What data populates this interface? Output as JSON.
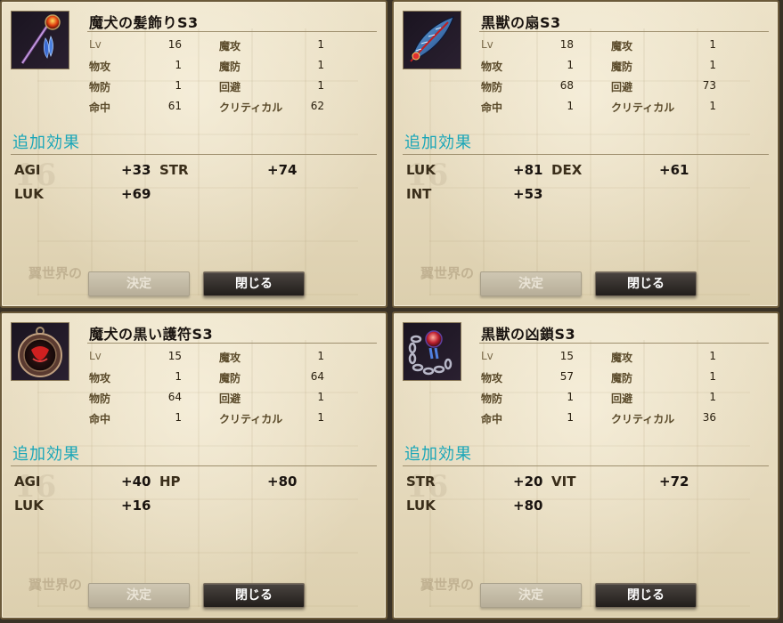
{
  "labels": {
    "lv": "Lv",
    "phys_atk": "物攻",
    "phys_def": "物防",
    "accuracy": "命中",
    "mag_atk": "魔攻",
    "mag_def": "魔防",
    "evasion": "回避",
    "critical": "クリティカル",
    "additional_effects": "追加効果",
    "decide_button": "決定",
    "close_button": "閉じる",
    "watermark": "翼世界の",
    "bg_number": "16"
  },
  "panels": [
    {
      "title": "魔犬の髪飾りS3",
      "icon": "hair-ornament-icon",
      "stats": {
        "lv": "16",
        "mag_atk": "1",
        "phys_atk": "1",
        "mag_def": "1",
        "phys_def": "1",
        "evasion": "1",
        "accuracy": "61",
        "critical": "62"
      },
      "bonuses": [
        {
          "n1": "AGI",
          "v1": "+33",
          "n2": "STR",
          "v2": "+74"
        },
        {
          "n1": "LUK",
          "v1": "+69",
          "n2": "",
          "v2": ""
        }
      ]
    },
    {
      "title": "黒獣の扇S3",
      "icon": "feather-fan-icon",
      "stats": {
        "lv": "18",
        "mag_atk": "1",
        "phys_atk": "1",
        "mag_def": "1",
        "phys_def": "68",
        "evasion": "73",
        "accuracy": "1",
        "critical": "1"
      },
      "bonuses": [
        {
          "n1": "LUK",
          "v1": "+81",
          "n2": "DEX",
          "v2": "+61"
        },
        {
          "n1": "INT",
          "v1": "+53",
          "n2": "",
          "v2": ""
        }
      ]
    },
    {
      "title": "魔犬の黒い護符S3",
      "icon": "amulet-icon",
      "stats": {
        "lv": "15",
        "mag_atk": "1",
        "phys_atk": "1",
        "mag_def": "64",
        "phys_def": "64",
        "evasion": "1",
        "accuracy": "1",
        "critical": "1"
      },
      "bonuses": [
        {
          "n1": "AGI",
          "v1": "+40",
          "n2": "HP",
          "v2": "+80"
        },
        {
          "n1": "LUK",
          "v1": "+16",
          "n2": "",
          "v2": ""
        }
      ]
    },
    {
      "title": "黒獣の凶鎖S3",
      "icon": "chain-icon",
      "stats": {
        "lv": "15",
        "mag_atk": "1",
        "phys_atk": "57",
        "mag_def": "1",
        "phys_def": "1",
        "evasion": "1",
        "accuracy": "1",
        "critical": "36"
      },
      "bonuses": [
        {
          "n1": "STR",
          "v1": "+20",
          "n2": "VIT",
          "v2": "+72"
        },
        {
          "n1": "LUK",
          "v1": "+80",
          "n2": "",
          "v2": ""
        }
      ]
    }
  ]
}
